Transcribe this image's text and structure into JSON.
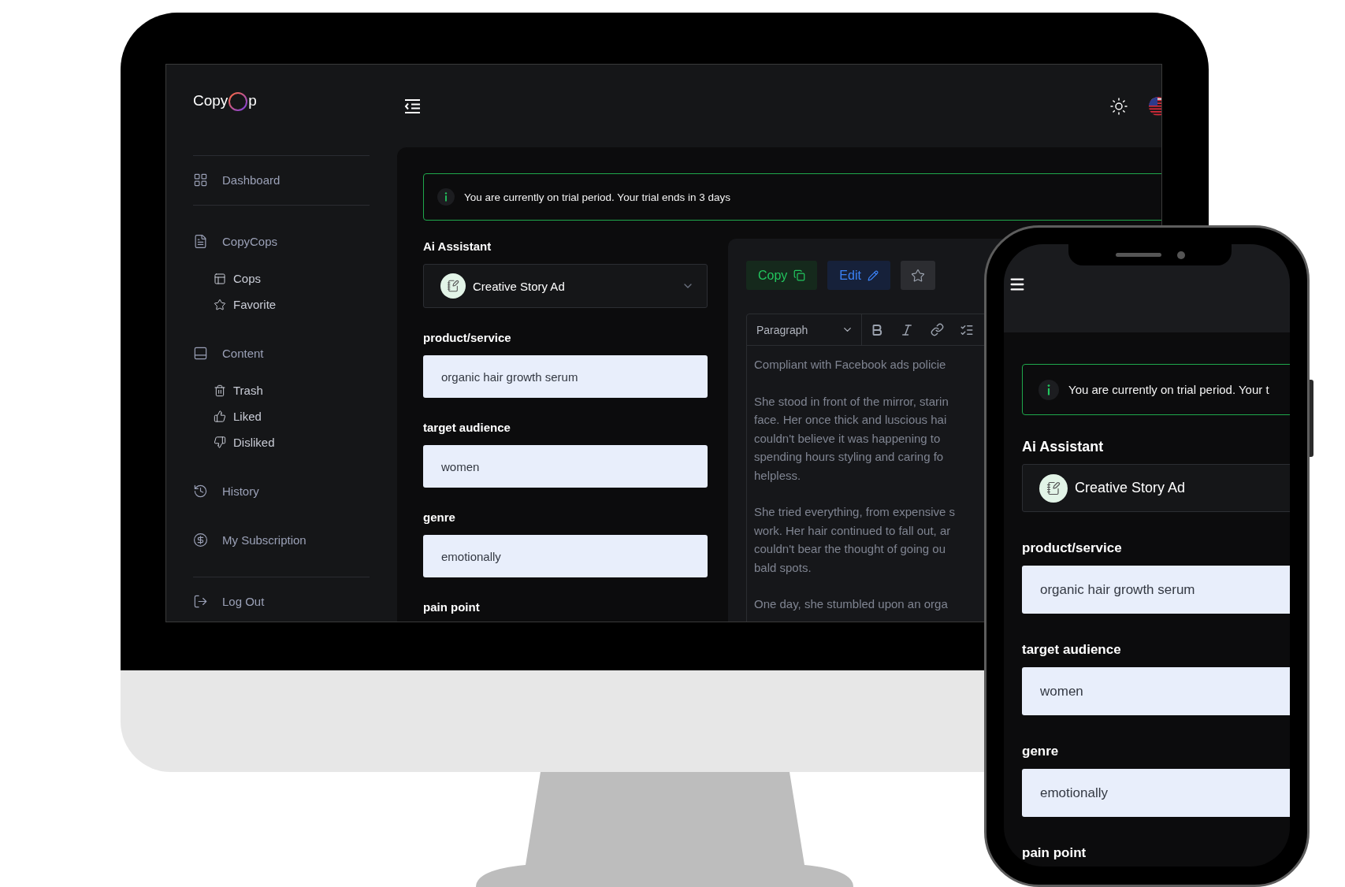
{
  "desktop": {
    "logo": {
      "before": "Copy",
      "after": "p"
    },
    "sidebar": [
      {
        "label": "Dashboard"
      },
      {
        "label": "CopyCops",
        "children": [
          {
            "label": "Cops"
          },
          {
            "label": "Favorite"
          }
        ]
      },
      {
        "label": "Content",
        "children": [
          {
            "label": "Trash"
          },
          {
            "label": "Liked"
          },
          {
            "label": "Disliked"
          }
        ]
      },
      {
        "label": "History"
      },
      {
        "label": "My Subscription"
      },
      {
        "label": "Log Out"
      }
    ],
    "banner": "You are currently on trial period. Your trial ends in 3 days",
    "assistant": {
      "label": "Ai Assistant",
      "value": "Creative Story Ad"
    },
    "fields": [
      {
        "label": "product/service",
        "value": "organic hair growth serum"
      },
      {
        "label": "target audience",
        "value": "women"
      },
      {
        "label": "genre",
        "value": "emotionally"
      },
      {
        "label": "pain point"
      }
    ],
    "editor": {
      "buttons": [
        {
          "kind": "copy",
          "label": "Copy"
        },
        {
          "kind": "edit",
          "label": "Edit"
        },
        {
          "kind": "favorite"
        }
      ],
      "format": "Paragraph",
      "paragraphs": [
        [
          "Compliant with Facebook ads policie"
        ],
        [
          "She stood in front of the mirror, starin",
          "face. Her once thick and luscious hai",
          "couldn't believe it was happening to",
          "spending hours styling and caring fo",
          "helpless."
        ],
        [
          "She tried everything, from expensive s",
          "work. Her hair continued to fall out, ar",
          "couldn't bear the thought of going ou",
          "bald spots."
        ],
        [
          "One day, she stumbled upon an orga"
        ]
      ]
    }
  },
  "phone": {
    "banner": "You are currently on trial period. Your t",
    "assistant": {
      "label": "Ai Assistant",
      "value": "Creative Story Ad"
    },
    "fields": [
      {
        "label": "product/service",
        "value": "organic hair growth serum"
      },
      {
        "label": "target audience",
        "value": "women"
      },
      {
        "label": "genre",
        "value": "emotionally"
      },
      {
        "label": "pain point"
      }
    ]
  }
}
